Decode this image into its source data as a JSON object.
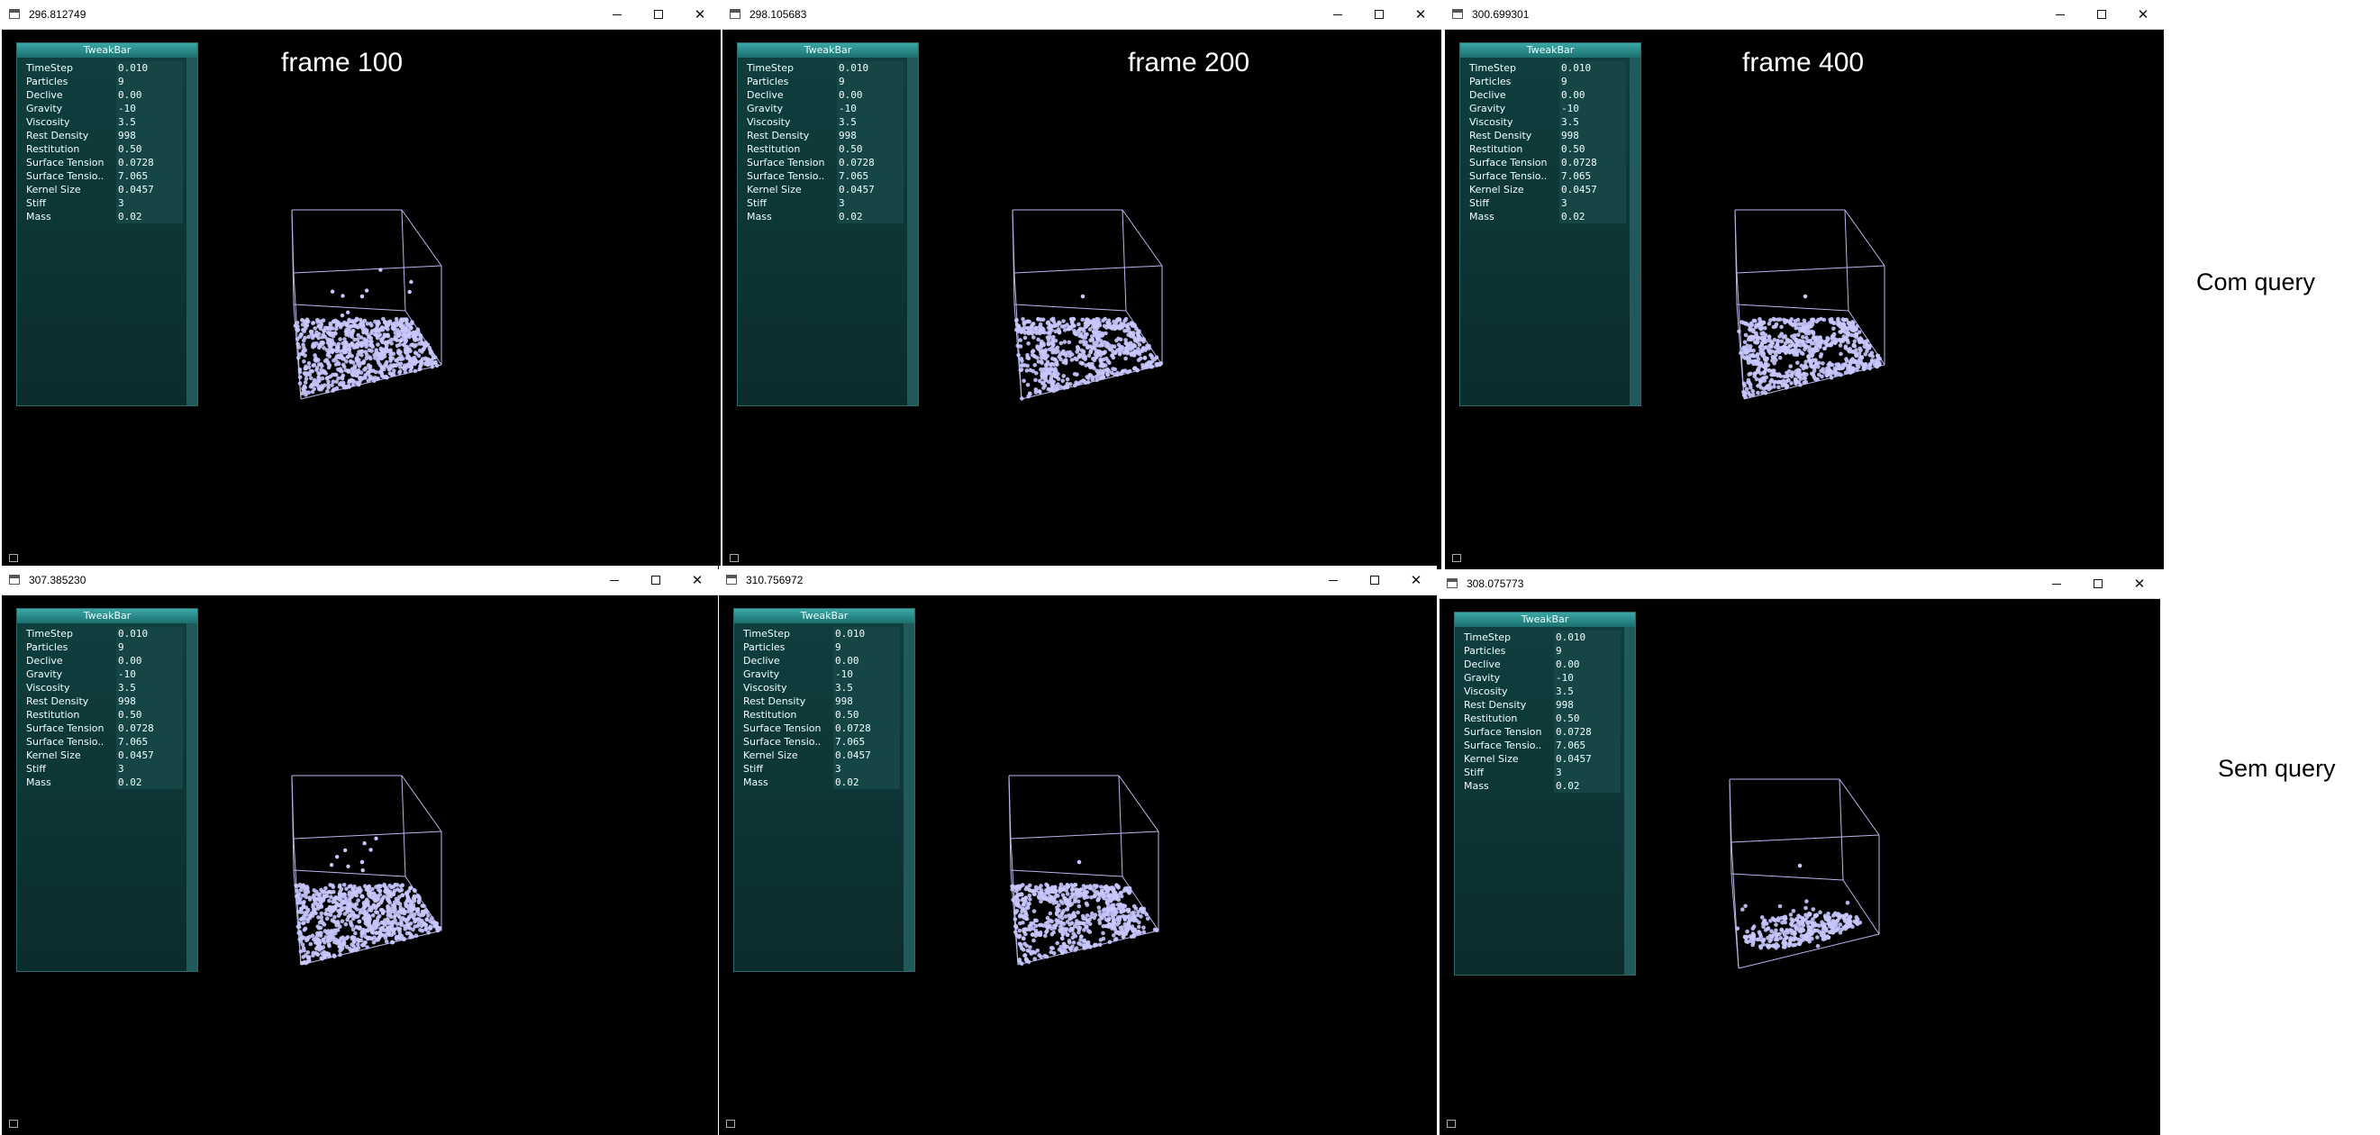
{
  "windows": [
    {
      "title": "296.812749",
      "frame_label": "frame 100",
      "variant": "scatter"
    },
    {
      "title": "298.105683",
      "frame_label": "frame 200",
      "variant": "clumps"
    },
    {
      "title": "300.699301",
      "frame_label": "frame 400",
      "variant": "clumps"
    },
    {
      "title": "307.385230",
      "frame_label": "",
      "variant": "scatter"
    },
    {
      "title": "310.756972",
      "frame_label": "",
      "variant": "clumps"
    },
    {
      "title": "308.075773",
      "frame_label": "",
      "variant": "blob"
    }
  ],
  "tweakbar": {
    "title": "TweakBar",
    "rows": [
      {
        "label": "TimeStep",
        "value": "0.010"
      },
      {
        "label": "Particles",
        "value": "9"
      },
      {
        "label": "Declive",
        "value": "0.00"
      },
      {
        "label": "Gravity",
        "value": "-10"
      },
      {
        "label": "Viscosity",
        "value": "3.5"
      },
      {
        "label": "Rest Density",
        "value": "998"
      },
      {
        "label": "Restitution",
        "value": "0.50"
      },
      {
        "label": "Surface Tension",
        "value": "0.0728"
      },
      {
        "label": "Surface Tensio..",
        "value": "7.065"
      },
      {
        "label": "Kernel Size",
        "value": "0.0457"
      },
      {
        "label": "Stiff",
        "value": "3"
      },
      {
        "label": "Mass",
        "value": "0.02"
      }
    ]
  },
  "row_labels": {
    "top": "Com query",
    "bottom": "Sem query"
  },
  "colors": {
    "particle": "#c8c8ff",
    "wireframe": "#b8b8ee",
    "tweakbar_title": "#2a9090",
    "tweakbar_bg": "#0d3535"
  },
  "icons": {
    "window": "app-icon",
    "minimize": "minimize-icon",
    "maximize": "maximize-icon",
    "close": "close-icon"
  }
}
